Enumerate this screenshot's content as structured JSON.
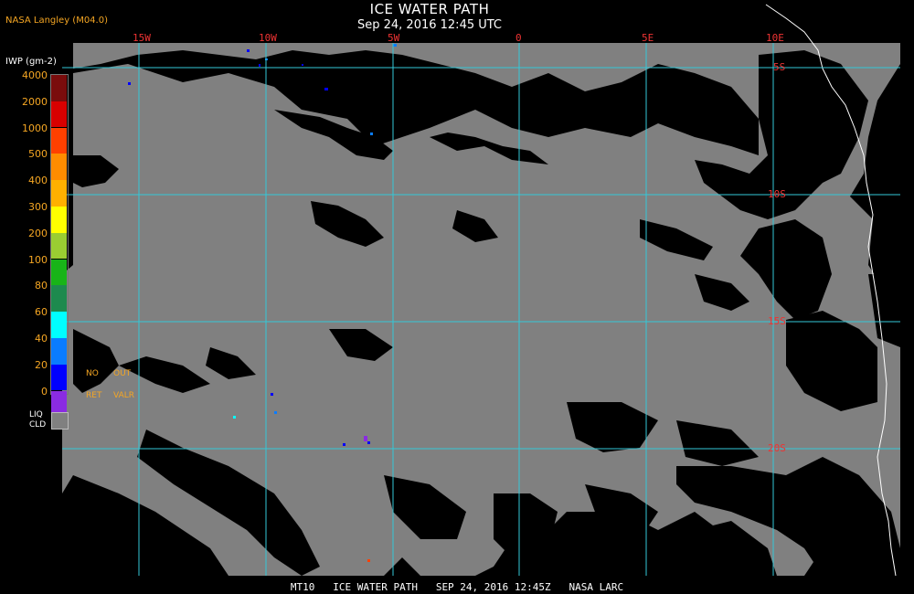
{
  "header": {
    "title": "ICE WATER PATH",
    "subtitle": "Sep 24, 2016 12:45 UTC",
    "source": "NASA Langley (M04.0)"
  },
  "legend": {
    "title": "IWP (gm-2)",
    "levels": [
      {
        "label": "4000",
        "color": "#7a0c0c"
      },
      {
        "label": "2000",
        "color": "#d80000"
      },
      {
        "label": "1000",
        "color": "#ff4000"
      },
      {
        "label": "500",
        "color": "#ff8c00"
      },
      {
        "label": "400",
        "color": "#ffb000"
      },
      {
        "label": "300",
        "color": "#ffff00"
      },
      {
        "label": "200",
        "color": "#9acd32"
      },
      {
        "label": "100",
        "color": "#18b418"
      },
      {
        "label": "80",
        "color": "#1d8a4e"
      },
      {
        "label": "60",
        "color": "#00ffff"
      },
      {
        "label": "40",
        "color": "#0a7cff"
      },
      {
        "label": "20",
        "color": "#0000ff"
      },
      {
        "label": "0",
        "color": "#8a2be2"
      }
    ],
    "flags": {
      "no": "NO",
      "out": "OUT",
      "ret": "RET",
      "valr": "VALR"
    },
    "liquid_cloud": {
      "line1": "LIQ",
      "line2": "CLD",
      "color": "#808080"
    }
  },
  "map": {
    "colors": {
      "cloud": "#808080",
      "clear": "#000000",
      "grid": "#33c8d8",
      "coastline": "#ffffff",
      "grid_label": "#e33333"
    },
    "longitudes": [
      "15W",
      "10W",
      "5W",
      "0",
      "5E",
      "10E"
    ],
    "latitudes": [
      "5S",
      "10S",
      "15S",
      "20S"
    ]
  },
  "footer": {
    "text": "MT10   ICE WATER PATH   SEP 24, 2016 12:45Z   NASA LARC"
  }
}
